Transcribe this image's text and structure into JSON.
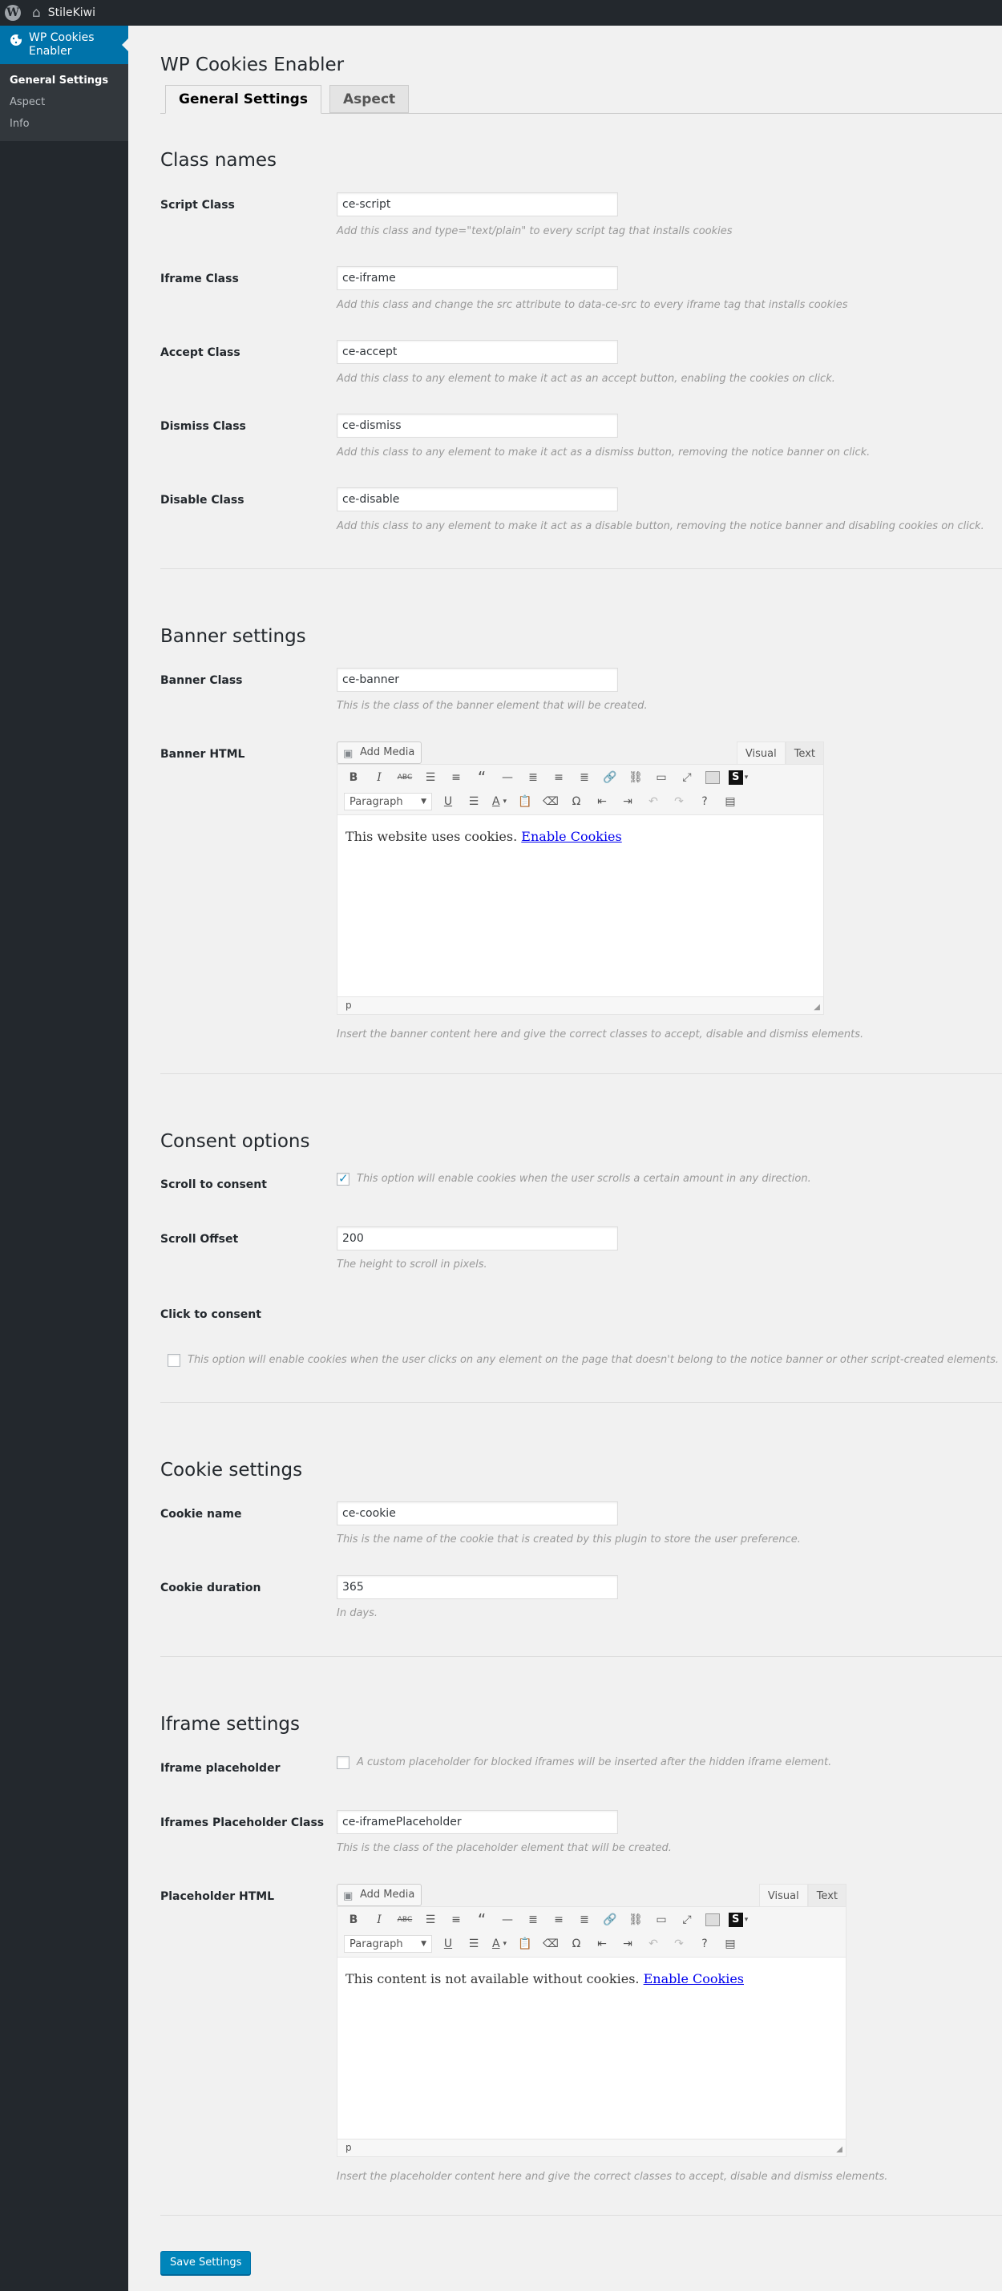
{
  "adminbar": {
    "site_name": "StileKiwi"
  },
  "sidebar": {
    "menu_label": "WP Cookies Enabler",
    "items": [
      {
        "label": "General Settings",
        "active": true
      },
      {
        "label": "Aspect",
        "active": false
      },
      {
        "label": "Info",
        "active": false
      }
    ]
  },
  "page": {
    "title": "WP Cookies Enabler",
    "tabs": [
      {
        "label": "General Settings",
        "active": true
      },
      {
        "label": "Aspect",
        "active": false
      }
    ]
  },
  "class_names": {
    "heading": "Class names",
    "fields": [
      {
        "label": "Script Class",
        "value": "ce-script",
        "description": "Add this class and type=\"text/plain\" to every script tag that installs cookies"
      },
      {
        "label": "Iframe Class",
        "value": "ce-iframe",
        "description": "Add this class and change the src attribute to data-ce-src to every iframe tag that installs cookies"
      },
      {
        "label": "Accept Class",
        "value": "ce-accept",
        "description": "Add this class to any element to make it act as an accept button, enabling the cookies on click."
      },
      {
        "label": "Dismiss Class",
        "value": "ce-dismiss",
        "description": "Add this class to any element to make it act as a dismiss button, removing the notice banner on click."
      },
      {
        "label": "Disable Class",
        "value": "ce-disable",
        "description": "Add this class to any element to make it act as a disable button, removing the notice banner and disabling cookies on click."
      }
    ]
  },
  "banner": {
    "heading": "Banner settings",
    "class_label": "Banner Class",
    "class_value": "ce-banner",
    "class_description": "This is the class of the banner element that will be created.",
    "html_label": "Banner HTML",
    "editor": {
      "add_media": "Add Media",
      "tab_visual": "Visual",
      "tab_text": "Text",
      "format": "Paragraph",
      "content_text": "This website uses cookies.",
      "content_link": "Enable Cookies",
      "path": "p"
    },
    "html_description": "Insert the banner content here and give the correct classes to accept, disable and dismiss elements."
  },
  "consent": {
    "heading": "Consent options",
    "scroll_label": "Scroll to consent",
    "scroll_checked": true,
    "scroll_description": "This option will enable cookies when the user scrolls a certain amount in any direction.",
    "offset_label": "Scroll Offset",
    "offset_value": "200",
    "offset_description": "The height to scroll in pixels.",
    "click_label": "Click to consent",
    "click_checked": false,
    "click_description": "This option will enable cookies when the user clicks on any element on the page that doesn't belong to the notice banner or other script-created elements."
  },
  "cookie": {
    "heading": "Cookie settings",
    "name_label": "Cookie name",
    "name_value": "ce-cookie",
    "name_description": "This is the name of the cookie that is created by this plugin to store the user preference.",
    "duration_label": "Cookie duration",
    "duration_value": "365",
    "duration_description": "In days."
  },
  "iframe": {
    "heading": "Iframe settings",
    "placeholder_label": "Iframe placeholder",
    "placeholder_checked": false,
    "placeholder_description": "A custom placeholder for blocked iframes will be inserted after the hidden iframe element.",
    "class_label": "Iframes Placeholder Class",
    "class_value": "ce-iframePlaceholder",
    "class_description": "This is the class of the placeholder element that will be created.",
    "html_label": "Placeholder HTML",
    "editor": {
      "add_media": "Add Media",
      "tab_visual": "Visual",
      "tab_text": "Text",
      "format": "Paragraph",
      "content_text": "This content is not available without cookies.",
      "content_link": "Enable Cookies",
      "path": "p"
    },
    "html_description": "Insert the placeholder content here and give the correct classes to accept, disable and dismiss elements."
  },
  "save_label": "Save Settings",
  "colors": {
    "accent": "#0073aa",
    "button": "#0085ba",
    "adminbar": "#23282d"
  }
}
